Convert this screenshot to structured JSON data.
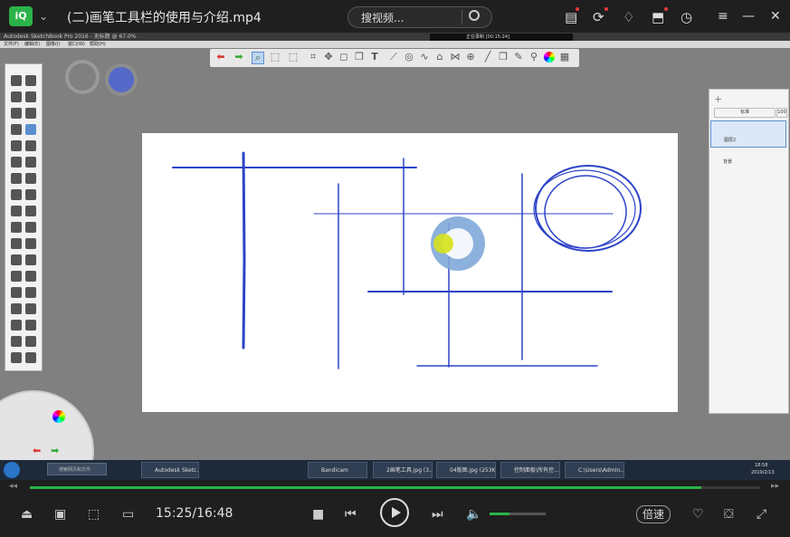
{
  "player": {
    "title": "(二)画笔工具栏的使用与介绍.mp4",
    "search_placeholder": "搜视频...",
    "current_time": "15:25/16:48",
    "speed_label": "倍速",
    "progress": 0.92,
    "volume": 0.35
  },
  "app": {
    "title": "Autodesk SketchBook Pro 2016 - 无标题 @ 67.0%",
    "menu": [
      "文件(F)",
      "编辑(E)",
      "图像(I)",
      "窗口(W)",
      "帮助(H)"
    ],
    "recording": "正在录制 [00:15:24]",
    "layers": {
      "blend": "标准",
      "opacity": "100",
      "layer_name": "图层2",
      "background": "背景"
    }
  },
  "taskbar": {
    "search_placeholder": "搜索网页和文件",
    "items": [
      "Autodesk Sketc...",
      "Bandicam",
      "2画笔工具.jpg (3...",
      "04版图.jpg (253K...",
      "控制面板\\所有控...",
      "C:\\Users\\Admin..."
    ],
    "clock_time": "18:58",
    "clock_date": "2019/2/13"
  }
}
